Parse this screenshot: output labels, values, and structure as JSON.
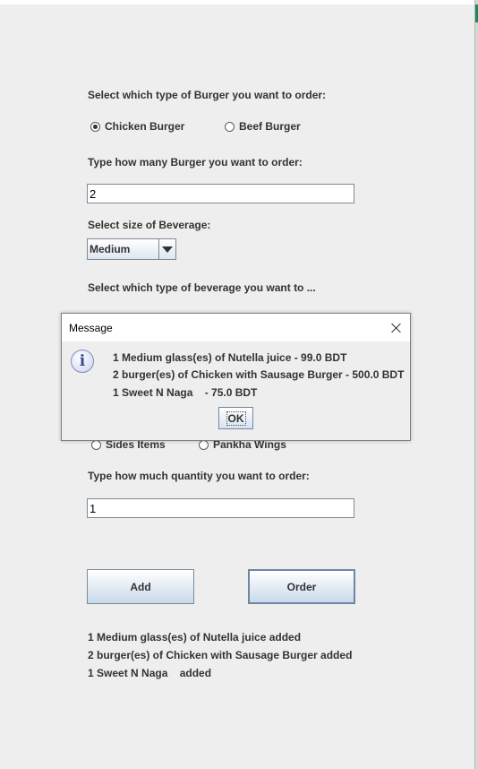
{
  "burger": {
    "prompt": "Select which type of Burger you want to order:",
    "options": [
      "Chicken Burger",
      "Beef Burger"
    ],
    "selected": "Chicken Burger"
  },
  "burger_qty": {
    "prompt": "Type how many Burger you want to order:",
    "value": "2"
  },
  "beverage_size": {
    "prompt": "Select size of Beverage:",
    "selected": "Medium"
  },
  "beverage_type": {
    "prompt": "Select which type of beverage you want to ..."
  },
  "sides": {
    "options": [
      "Sides Items",
      "Pankha Wings"
    ]
  },
  "quantity": {
    "prompt": "Type how much quantity you want to order:",
    "value": "1"
  },
  "buttons": {
    "add": "Add",
    "order": "Order"
  },
  "added_log": [
    "1 Medium glass(es) of Nutella juice added",
    "2 burger(es) of Chicken with Sausage Burger added",
    "1 Sweet N Naga    added"
  ],
  "dialog": {
    "title": "Message",
    "icon": "info-icon",
    "lines": [
      "1 Medium glass(es) of Nutella juice - 99.0 BDT",
      "2 burger(es) of Chicken with Sausage Burger - 500.0 BDT",
      "1 Sweet N Naga    - 75.0 BDT"
    ],
    "ok": "OK"
  }
}
